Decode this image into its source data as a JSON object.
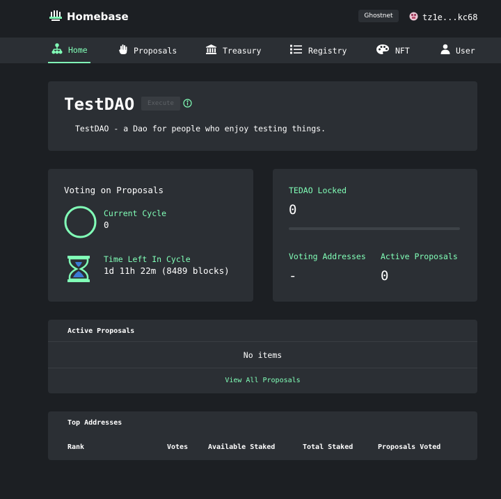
{
  "app": {
    "name": "Homebase"
  },
  "topbar": {
    "network": "Ghostnet",
    "account": "tz1e...kc68"
  },
  "nav": {
    "items": [
      {
        "label": "Home",
        "icon": "network-icon",
        "active": true
      },
      {
        "label": "Proposals",
        "icon": "hand-icon"
      },
      {
        "label": "Treasury",
        "icon": "bank-icon"
      },
      {
        "label": "Registry",
        "icon": "list-icon"
      },
      {
        "label": "NFT",
        "icon": "palette-icon"
      },
      {
        "label": "User",
        "icon": "user-icon"
      }
    ]
  },
  "dao": {
    "name": "TestDAO",
    "badge": "Execute",
    "description": "TestDAO - a Dao for people who enjoy testing things."
  },
  "voting": {
    "heading": "Voting on Proposals",
    "cycle_label": "Current Cycle",
    "cycle_value": "0",
    "time_label": "Time Left In Cycle",
    "time_value": "1d 11h 22m (8489 blocks)"
  },
  "stats": {
    "locked_label": "TEDAO Locked",
    "locked_value": "0",
    "locked_progress": 0,
    "voting_addresses_label": "Voting Addresses",
    "voting_addresses_value": "-",
    "active_proposals_label": "Active Proposals",
    "active_proposals_value": "0"
  },
  "active_proposals": {
    "title": "Active Proposals",
    "empty_text": "No items",
    "view_all": "View All Proposals"
  },
  "top_addresses": {
    "title": "Top Addresses",
    "columns": [
      "Rank",
      "Votes",
      "Available Staked",
      "Total Staked",
      "Proposals Voted"
    ]
  },
  "colors": {
    "accent": "#81feb7",
    "background": "#1c1f23",
    "card": "#2b2f34"
  }
}
